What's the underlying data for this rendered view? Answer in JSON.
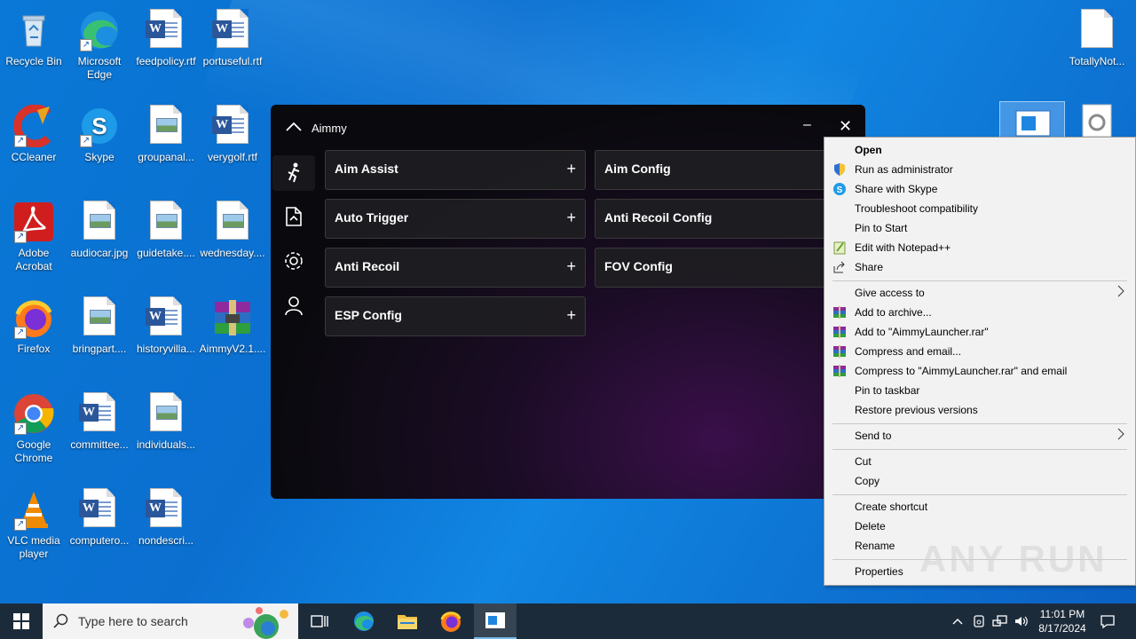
{
  "desktop": {
    "icons": [
      {
        "label": "Recycle Bin",
        "icon": "recycle-bin-icon"
      },
      {
        "label": "Microsoft Edge",
        "icon": "edge-icon"
      },
      {
        "label": "feedpolicy.rtf",
        "icon": "word-doc-icon"
      },
      {
        "label": "portuseful.rtf",
        "icon": "word-doc-icon"
      },
      {
        "label": "CCleaner",
        "icon": "ccleaner-icon"
      },
      {
        "label": "Skype",
        "icon": "skype-icon"
      },
      {
        "label": "groupanal...",
        "icon": "image-file-icon"
      },
      {
        "label": "verygolf.rtf",
        "icon": "word-doc-icon"
      },
      {
        "label": "Adobe Acrobat",
        "icon": "acrobat-icon"
      },
      {
        "label": "audiocar.jpg",
        "icon": "image-file-icon"
      },
      {
        "label": "guidetake....",
        "icon": "image-file-icon"
      },
      {
        "label": "wednesday....",
        "icon": "image-file-icon"
      },
      {
        "label": "Firefox",
        "icon": "firefox-icon"
      },
      {
        "label": "bringpart....",
        "icon": "image-file-icon"
      },
      {
        "label": "historyvilla...",
        "icon": "word-doc-icon"
      },
      {
        "label": "AimmyV2.1....",
        "icon": "winrar-archive-icon"
      },
      {
        "label": "Google Chrome",
        "icon": "chrome-icon"
      },
      {
        "label": "committee...",
        "icon": "word-doc-icon"
      },
      {
        "label": "individuals...",
        "icon": "image-file-icon"
      },
      {
        "label": "VLC media player",
        "icon": "vlc-icon"
      },
      {
        "label": "computero...",
        "icon": "word-doc-icon"
      },
      {
        "label": "nondescri...",
        "icon": "word-doc-icon"
      },
      {
        "label": "TotallyNot...",
        "icon": "blank-file-icon"
      }
    ]
  },
  "aimmy": {
    "title": "Aimmy",
    "cards_left": [
      {
        "label": "Aim Assist",
        "action": "+"
      },
      {
        "label": "Auto Trigger",
        "action": "+"
      },
      {
        "label": "Anti Recoil",
        "action": "+"
      },
      {
        "label": "ESP Config",
        "action": "+"
      }
    ],
    "cards_right": [
      {
        "label": "Aim Config"
      },
      {
        "label": "Anti Recoil Config"
      },
      {
        "label": "FOV Config"
      }
    ],
    "min_glyph": "–",
    "close_glyph": "✕"
  },
  "context_menu": {
    "items": [
      {
        "label": "Open",
        "bold": true
      },
      {
        "label": "Run as administrator",
        "icon": "shield-icon"
      },
      {
        "label": "Share with Skype",
        "icon": "skype-icon"
      },
      {
        "label": "Troubleshoot compatibility"
      },
      {
        "label": "Pin to Start"
      },
      {
        "label": "Edit with Notepad++",
        "icon": "notepadpp-icon"
      },
      {
        "label": "Share",
        "icon": "share-icon"
      },
      {
        "label": "Give access to",
        "submenu": true
      },
      {
        "label": "Add to archive...",
        "icon": "winrar-icon"
      },
      {
        "label": "Add to \"AimmyLauncher.rar\"",
        "icon": "winrar-icon"
      },
      {
        "label": "Compress and email...",
        "icon": "winrar-icon"
      },
      {
        "label": "Compress to \"AimmyLauncher.rar\" and email",
        "icon": "winrar-icon"
      },
      {
        "label": "Pin to taskbar"
      },
      {
        "label": "Restore previous versions"
      },
      {
        "label": "Send to",
        "submenu": true
      },
      {
        "label": "Cut"
      },
      {
        "label": "Copy"
      },
      {
        "label": "Create shortcut"
      },
      {
        "label": "Delete"
      },
      {
        "label": "Rename"
      },
      {
        "label": "Properties"
      }
    ]
  },
  "taskbar": {
    "search_placeholder": "Type here to search",
    "time": "11:01 PM",
    "date": "8/17/2024"
  },
  "watermark": "ANY RUN"
}
